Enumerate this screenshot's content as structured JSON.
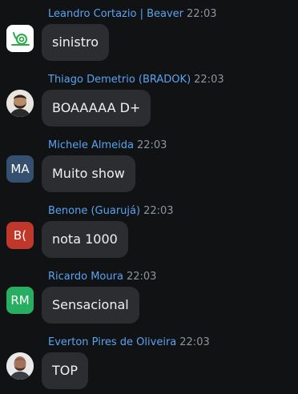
{
  "messages": [
    {
      "sender": "Leandro Cortazio | Beaver",
      "time": "22:03",
      "text": "sinistro",
      "avatar": {
        "type": "logo",
        "icon": "snail-logo-icon",
        "bg": "#ffffff",
        "color": "#2ea84a"
      }
    },
    {
      "sender": "Thiago Demetrio (BRADOK)",
      "time": "22:03",
      "text": "BOAAAAA D+",
      "avatar": {
        "type": "photo",
        "icon": "bearded-man-photo",
        "bg": "#e8e4df"
      }
    },
    {
      "sender": "Michele Almeida",
      "time": "22:03",
      "text": "Muito show",
      "avatar": {
        "type": "initials",
        "initials": "MA",
        "bg": "#35506e"
      }
    },
    {
      "sender": "Benone (Guarujá)",
      "time": "22:03",
      "text": "nota 1000",
      "avatar": {
        "type": "initials",
        "initials": "B(",
        "bg": "#c0382b"
      }
    },
    {
      "sender": "Ricardo Moura",
      "time": "22:03",
      "text": "Sensacional",
      "avatar": {
        "type": "initials",
        "initials": "RM",
        "bg": "#27ae60"
      }
    },
    {
      "sender": "Everton Pires de Oliveira",
      "time": "22:03",
      "text": "TOP",
      "avatar": {
        "type": "photo",
        "icon": "bald-man-photo",
        "bg": "#e9e9e9"
      }
    }
  ]
}
